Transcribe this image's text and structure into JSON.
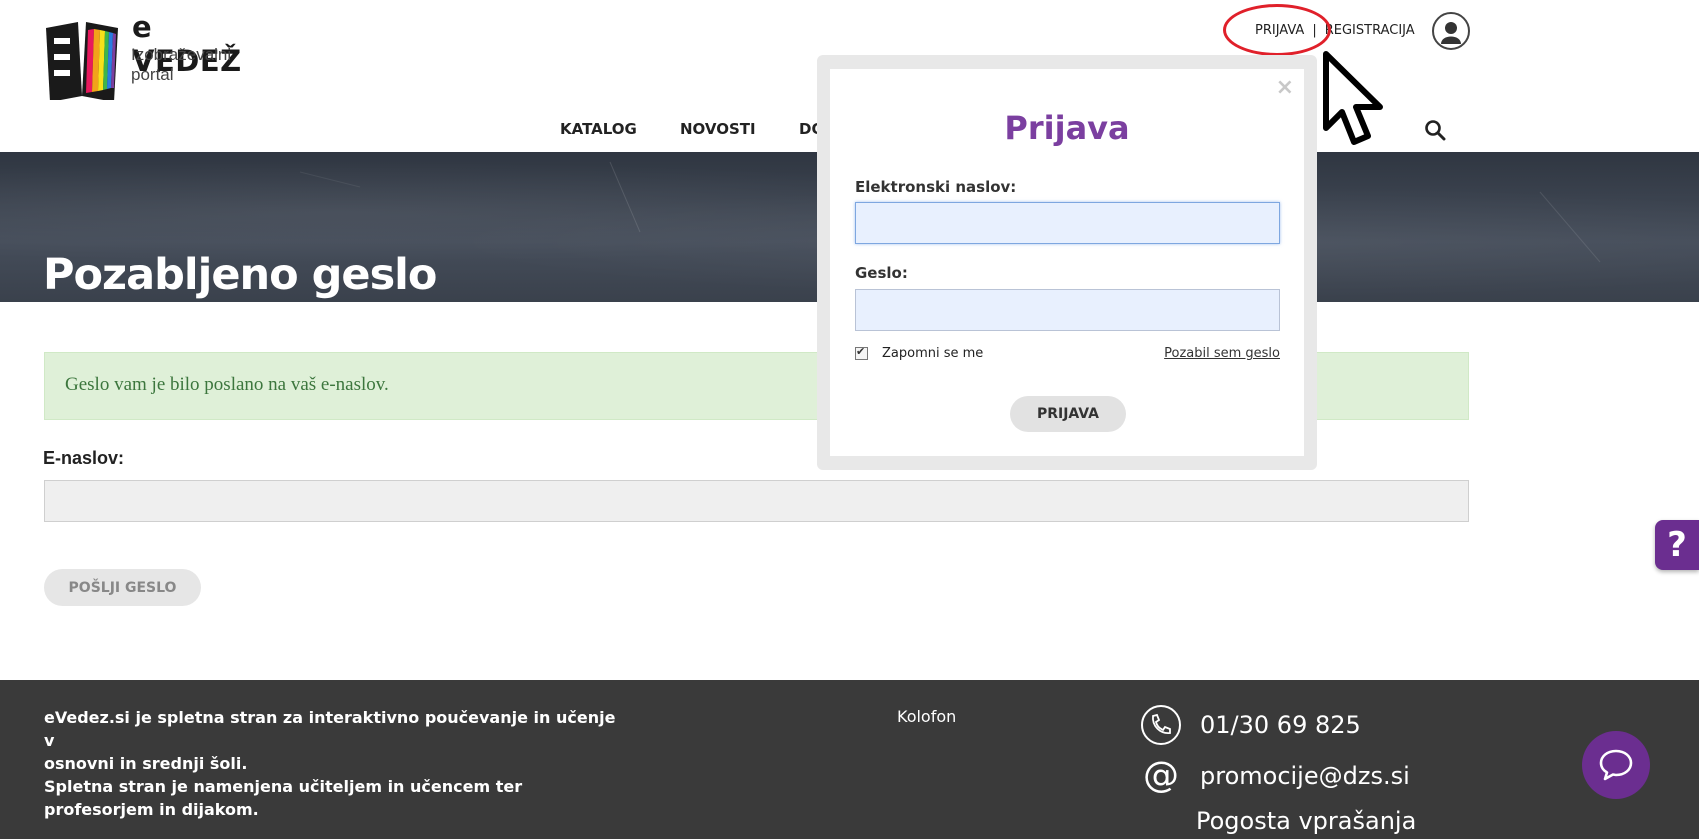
{
  "logo": {
    "title": "e VEDEŽ",
    "subtitle_line1": "Izobraževalni",
    "subtitle_line2": "portal"
  },
  "top_links": {
    "login": "PRIJAVA",
    "separator": "|",
    "register": "REGISTRACIJA"
  },
  "nav": {
    "items": [
      {
        "label": "KATALOG",
        "color": "#e8195d"
      },
      {
        "label": "NOVOSTI",
        "color": "#f2a21b"
      },
      {
        "label": "DO",
        "color": "#3db54a"
      }
    ],
    "last_bar_color": "#7b3fa0",
    "end_bar_color": "#d9d9d9"
  },
  "hero": {
    "title": "Pozabljeno geslo"
  },
  "alert": {
    "text": "Geslo vam je bilo poslano na vaš e-naslov."
  },
  "form": {
    "email_label": "E-naslov:",
    "email_value": "",
    "send_button": "POŠLJI GESLO"
  },
  "modal": {
    "close": "×",
    "title": "Prijava",
    "email_label": "Elektronski naslov:",
    "email_value": "",
    "password_label": "Geslo:",
    "password_value": "",
    "remember_label": "Zapomni se me",
    "remember_checked": true,
    "forgot_link": "Pozabil sem geslo",
    "submit": "PRIJAVA"
  },
  "help_tab": {
    "label": "?"
  },
  "footer": {
    "about_line1": "eVedez.si je spletna stran za interaktivno poučevanje in učenje v",
    "about_line2": "osnovni in srednji šoli.",
    "about_line3": "Spletna stran je namenjena učiteljem in učencem ter",
    "about_line4": "profesorjem in dijakom.",
    "kolofon": "Kolofon",
    "phone": "01/30 69 825",
    "email": "promocije@dzs.si",
    "faq": "Pogosta vprašanja"
  },
  "colors": {
    "brand_purple": "#7b3fa0",
    "alert_green_bg": "#dff0d8",
    "footer_bg": "#3a3a3a"
  }
}
